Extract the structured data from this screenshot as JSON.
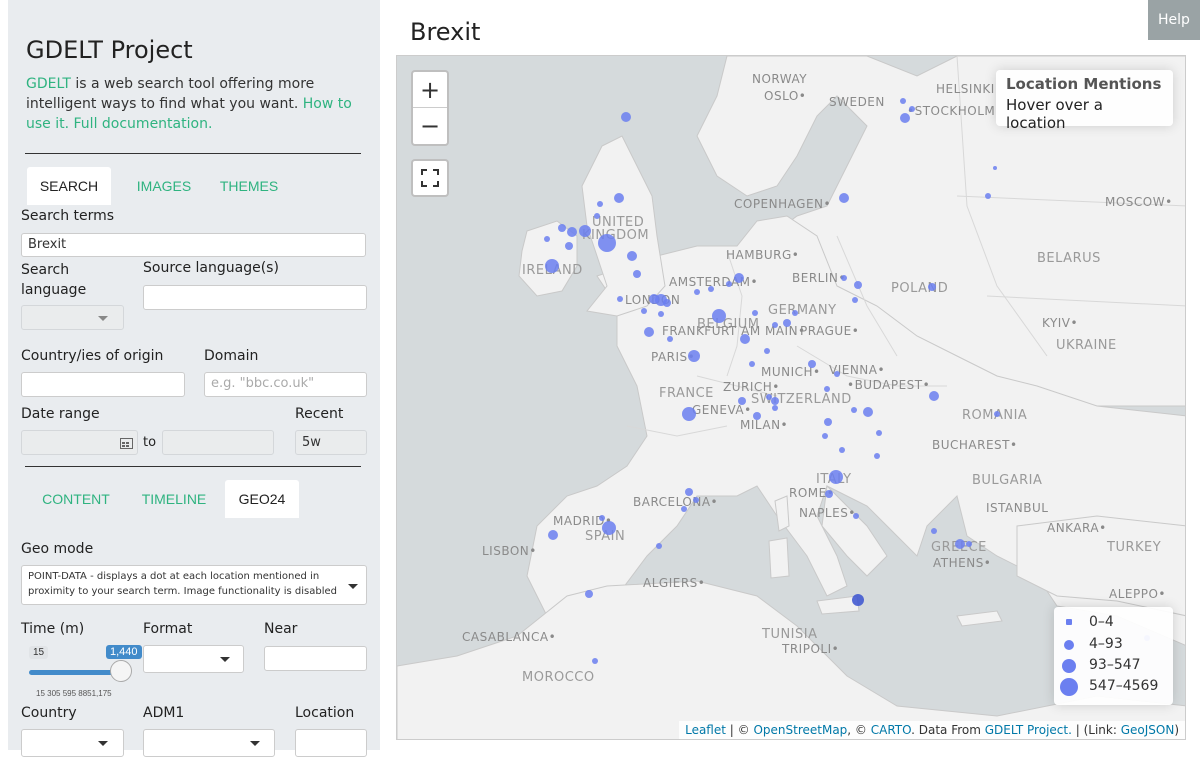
{
  "sidebar": {
    "title": "GDELT Project",
    "intro": {
      "brand": "GDELT",
      "text": " is a web search tool offering more intelligent ways to find what you want. ",
      "howto": "How to use it.",
      "docs": "Full documentation."
    },
    "tabs": [
      "SEARCH",
      "IMAGES",
      "THEMES"
    ],
    "search_terms_label": "Search terms",
    "search_terms_value": "Brexit",
    "search_language_label": "Search language",
    "source_language_label": "Source language(s)",
    "country_origin_label": "Country/ies of origin",
    "domain_label": "Domain",
    "domain_placeholder": "e.g. \"bbc.co.uk\"",
    "date_range_label": "Date range",
    "date_to": "to",
    "recent_label": "Recent",
    "recent_value": "5w",
    "output_tabs": [
      "CONTENT",
      "TIMELINE",
      "GEO24"
    ],
    "geo_mode_label": "Geo mode",
    "geo_mode_value": "POINT-DATA - displays a dot at each location mentioned in proximity to your search term. Image functionality is disabled",
    "time_label": "Time (m)",
    "format_label": "Format",
    "near_label": "Near",
    "slider": {
      "min": "15",
      "max": "1,440",
      "ticks": "15  305 595 8851,175",
      "value_fraction": 1.0
    },
    "country_label": "Country",
    "adm1_label": "ADM1",
    "location_label": "Location"
  },
  "main": {
    "title": "Brexit",
    "help": "Help",
    "zoom_in": "+",
    "zoom_out": "−",
    "info_title": "Location Mentions",
    "info_text": "Hover over a location",
    "legend": [
      "0–4",
      "4–93",
      "93–547",
      "547–4569"
    ],
    "attribution": {
      "leaflet": "Leaflet",
      "sep1": " | © ",
      "osm": "OpenStreetMap",
      "sep2": ", © ",
      "carto": "CARTO",
      "sep3": ". Data From ",
      "gdelt": "GDELT Project.",
      "sep4": " | (Link: ",
      "geojson": "GeoJSON",
      "end": ")"
    },
    "map_labels": {
      "cities": [
        "NORWAY",
        "OSLO",
        "SWEDEN",
        "HELSINKI",
        "STOCKHOLM",
        "COPENHAGEN",
        "MOSCOW",
        "UNITED",
        "KINGDOM",
        "IRELAND",
        "HAMBURG",
        "BERLIN",
        "AMSTERDAM",
        "LONDON",
        "BELGIUM",
        "GERMANY",
        "POLAND",
        "BELARUS",
        "FRANKFURT AM MAIN",
        "PRAGUE",
        "KYIV",
        "UKRAINE",
        "PARIS",
        "MUNICH",
        "VIENNA",
        "FRANCE",
        "ZURICH",
        "SWITZERLAND",
        "BUDAPEST",
        "GENEVA",
        "MILAN",
        "ROMANIA",
        "BUCHAREST",
        "BARCELONA",
        "ITALY",
        "ROME",
        "BULGARIA",
        "MADRID",
        "SPAIN",
        "NAPLES",
        "ISTANBUL",
        "ANKARA",
        "LISBON",
        "GREECE",
        "ATHENS",
        "TURKEY",
        "ALGIERS",
        "ALEPPO",
        "CASABLANCA",
        "TUNISIA",
        "TRIPOLI",
        "MOROCCO"
      ]
    }
  },
  "colors": {
    "accent": "#2fb380",
    "dot": "#6b7ff0",
    "slider": "#428bca"
  }
}
